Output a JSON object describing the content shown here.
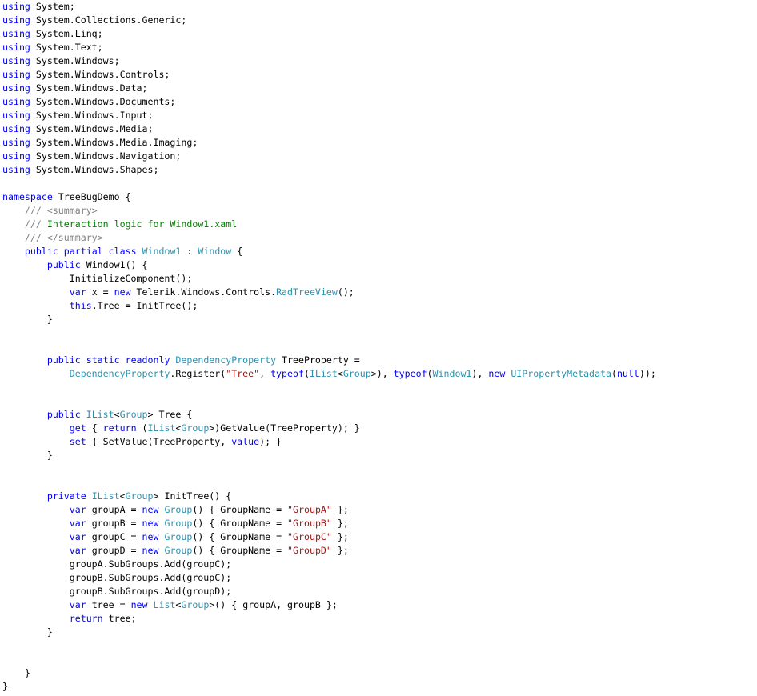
{
  "colors": {
    "keyword": "#0000ff",
    "type": "#2b91af",
    "string": "#a31515",
    "comment": "#008000",
    "doc_tag": "#808080",
    "text": "#000000",
    "background": "#ffffff"
  },
  "code_lines": [
    [
      [
        "kw",
        "using"
      ],
      [
        "p",
        " System;"
      ]
    ],
    [
      [
        "kw",
        "using"
      ],
      [
        "p",
        " System.Collections.Generic;"
      ]
    ],
    [
      [
        "kw",
        "using"
      ],
      [
        "p",
        " System.Linq;"
      ]
    ],
    [
      [
        "kw",
        "using"
      ],
      [
        "p",
        " System.Text;"
      ]
    ],
    [
      [
        "kw",
        "using"
      ],
      [
        "p",
        " System.Windows;"
      ]
    ],
    [
      [
        "kw",
        "using"
      ],
      [
        "p",
        " System.Windows.Controls;"
      ]
    ],
    [
      [
        "kw",
        "using"
      ],
      [
        "p",
        " System.Windows.Data;"
      ]
    ],
    [
      [
        "kw",
        "using"
      ],
      [
        "p",
        " System.Windows.Documents;"
      ]
    ],
    [
      [
        "kw",
        "using"
      ],
      [
        "p",
        " System.Windows.Input;"
      ]
    ],
    [
      [
        "kw",
        "using"
      ],
      [
        "p",
        " System.Windows.Media;"
      ]
    ],
    [
      [
        "kw",
        "using"
      ],
      [
        "p",
        " System.Windows.Media.Imaging;"
      ]
    ],
    [
      [
        "kw",
        "using"
      ],
      [
        "p",
        " System.Windows.Navigation;"
      ]
    ],
    [
      [
        "kw",
        "using"
      ],
      [
        "p",
        " System.Windows.Shapes;"
      ]
    ],
    [],
    [
      [
        "kw",
        "namespace"
      ],
      [
        "p",
        " TreeBugDemo {"
      ]
    ],
    [
      [
        "p",
        "    "
      ],
      [
        "cg",
        "/// <summary>"
      ]
    ],
    [
      [
        "p",
        "    "
      ],
      [
        "cg",
        "///"
      ],
      [
        "cm",
        " Interaction logic for Window1.xaml"
      ]
    ],
    [
      [
        "p",
        "    "
      ],
      [
        "cg",
        "/// </summary>"
      ]
    ],
    [
      [
        "p",
        "    "
      ],
      [
        "kw",
        "public"
      ],
      [
        "p",
        " "
      ],
      [
        "kw",
        "partial"
      ],
      [
        "p",
        " "
      ],
      [
        "kw",
        "class"
      ],
      [
        "p",
        " "
      ],
      [
        "ty",
        "Window1"
      ],
      [
        "p",
        " : "
      ],
      [
        "ty",
        "Window"
      ],
      [
        "p",
        " {"
      ]
    ],
    [
      [
        "p",
        "        "
      ],
      [
        "kw",
        "public"
      ],
      [
        "p",
        " Window1() {"
      ]
    ],
    [
      [
        "p",
        "            InitializeComponent();"
      ]
    ],
    [
      [
        "p",
        "            "
      ],
      [
        "kw",
        "var"
      ],
      [
        "p",
        " x = "
      ],
      [
        "kw",
        "new"
      ],
      [
        "p",
        " Telerik.Windows.Controls."
      ],
      [
        "ty",
        "RadTreeView"
      ],
      [
        "p",
        "();"
      ]
    ],
    [
      [
        "p",
        "            "
      ],
      [
        "kw",
        "this"
      ],
      [
        "p",
        ".Tree = InitTree();"
      ]
    ],
    [
      [
        "p",
        "        }"
      ]
    ],
    [],
    [],
    [
      [
        "p",
        "        "
      ],
      [
        "kw",
        "public"
      ],
      [
        "p",
        " "
      ],
      [
        "kw",
        "static"
      ],
      [
        "p",
        " "
      ],
      [
        "kw",
        "readonly"
      ],
      [
        "p",
        " "
      ],
      [
        "ty",
        "DependencyProperty"
      ],
      [
        "p",
        " TreeProperty ="
      ]
    ],
    [
      [
        "p",
        "            "
      ],
      [
        "ty",
        "DependencyProperty"
      ],
      [
        "p",
        ".Register("
      ],
      [
        "st",
        "\"Tree\""
      ],
      [
        "p",
        ", "
      ],
      [
        "kw",
        "typeof"
      ],
      [
        "p",
        "("
      ],
      [
        "ty",
        "IList"
      ],
      [
        "p",
        "<"
      ],
      [
        "ty",
        "Group"
      ],
      [
        "p",
        ">), "
      ],
      [
        "kw",
        "typeof"
      ],
      [
        "p",
        "("
      ],
      [
        "ty",
        "Window1"
      ],
      [
        "p",
        "), "
      ],
      [
        "kw",
        "new"
      ],
      [
        "p",
        " "
      ],
      [
        "ty",
        "UIPropertyMetadata"
      ],
      [
        "p",
        "("
      ],
      [
        "kw",
        "null"
      ],
      [
        "p",
        "));"
      ]
    ],
    [],
    [],
    [
      [
        "p",
        "        "
      ],
      [
        "kw",
        "public"
      ],
      [
        "p",
        " "
      ],
      [
        "ty",
        "IList"
      ],
      [
        "p",
        "<"
      ],
      [
        "ty",
        "Group"
      ],
      [
        "p",
        "> Tree {"
      ]
    ],
    [
      [
        "p",
        "            "
      ],
      [
        "kw",
        "get"
      ],
      [
        "p",
        " { "
      ],
      [
        "kw",
        "return"
      ],
      [
        "p",
        " ("
      ],
      [
        "ty",
        "IList"
      ],
      [
        "p",
        "<"
      ],
      [
        "ty",
        "Group"
      ],
      [
        "p",
        ">)GetValue(TreeProperty); }"
      ]
    ],
    [
      [
        "p",
        "            "
      ],
      [
        "kw",
        "set"
      ],
      [
        "p",
        " { SetValue(TreeProperty, "
      ],
      [
        "kw",
        "value"
      ],
      [
        "p",
        "); }"
      ]
    ],
    [
      [
        "p",
        "        }"
      ]
    ],
    [],
    [],
    [
      [
        "p",
        "        "
      ],
      [
        "kw",
        "private"
      ],
      [
        "p",
        " "
      ],
      [
        "ty",
        "IList"
      ],
      [
        "p",
        "<"
      ],
      [
        "ty",
        "Group"
      ],
      [
        "p",
        "> InitTree() {"
      ]
    ],
    [
      [
        "p",
        "            "
      ],
      [
        "kw",
        "var"
      ],
      [
        "p",
        " groupA = "
      ],
      [
        "kw",
        "new"
      ],
      [
        "p",
        " "
      ],
      [
        "ty",
        "Group"
      ],
      [
        "p",
        "() { GroupName = "
      ],
      [
        "st",
        "\"GroupA\""
      ],
      [
        "p",
        " };"
      ]
    ],
    [
      [
        "p",
        "            "
      ],
      [
        "kw",
        "var"
      ],
      [
        "p",
        " groupB = "
      ],
      [
        "kw",
        "new"
      ],
      [
        "p",
        " "
      ],
      [
        "ty",
        "Group"
      ],
      [
        "p",
        "() { GroupName = "
      ],
      [
        "st",
        "\"GroupB\""
      ],
      [
        "p",
        " };"
      ]
    ],
    [
      [
        "p",
        "            "
      ],
      [
        "kw",
        "var"
      ],
      [
        "p",
        " groupC = "
      ],
      [
        "kw",
        "new"
      ],
      [
        "p",
        " "
      ],
      [
        "ty",
        "Group"
      ],
      [
        "p",
        "() { GroupName = "
      ],
      [
        "st",
        "\"GroupC\""
      ],
      [
        "p",
        " };"
      ]
    ],
    [
      [
        "p",
        "            "
      ],
      [
        "kw",
        "var"
      ],
      [
        "p",
        " groupD = "
      ],
      [
        "kw",
        "new"
      ],
      [
        "p",
        " "
      ],
      [
        "ty",
        "Group"
      ],
      [
        "p",
        "() { GroupName = "
      ],
      [
        "st",
        "\"GroupD\""
      ],
      [
        "p",
        " };"
      ]
    ],
    [
      [
        "p",
        "            groupA.SubGroups.Add(groupC);"
      ]
    ],
    [
      [
        "p",
        "            groupB.SubGroups.Add(groupC);"
      ]
    ],
    [
      [
        "p",
        "            groupB.SubGroups.Add(groupD);"
      ]
    ],
    [
      [
        "p",
        "            "
      ],
      [
        "kw",
        "var"
      ],
      [
        "p",
        " tree = "
      ],
      [
        "kw",
        "new"
      ],
      [
        "p",
        " "
      ],
      [
        "ty",
        "List"
      ],
      [
        "p",
        "<"
      ],
      [
        "ty",
        "Group"
      ],
      [
        "p",
        ">() { groupA, groupB };"
      ]
    ],
    [
      [
        "p",
        "            "
      ],
      [
        "kw",
        "return"
      ],
      [
        "p",
        " tree;"
      ]
    ],
    [
      [
        "p",
        "        }"
      ]
    ],
    [],
    [],
    [
      [
        "p",
        "    }"
      ]
    ],
    [
      [
        "p",
        "}"
      ]
    ]
  ]
}
